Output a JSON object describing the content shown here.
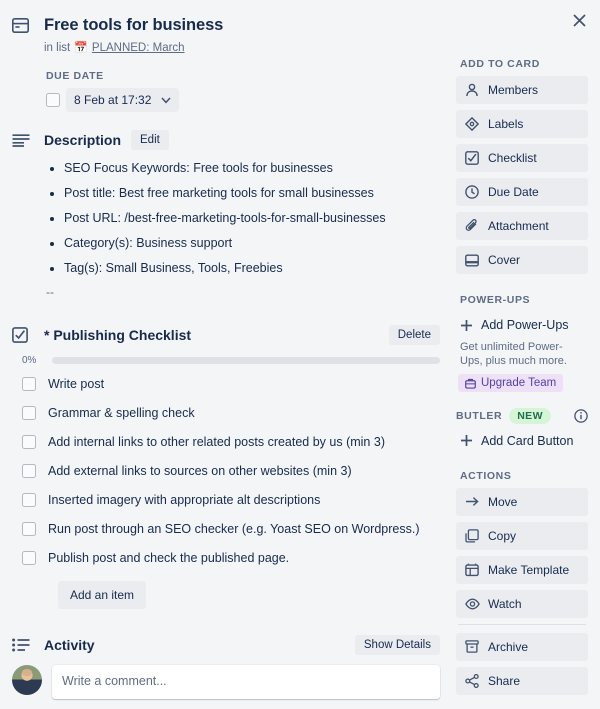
{
  "close_label": "×",
  "header": {
    "icon": "card-window-icon",
    "title": "Free tools for business",
    "in_list_prefix": "in list",
    "list_emoji": "📅",
    "list_name": "PLANNED: March"
  },
  "due": {
    "section_label": "DUE DATE",
    "value": "8 Feb at 17:32",
    "checked": false,
    "chevron": "chevron-down-icon"
  },
  "description": {
    "title": "Description",
    "edit_label": "Edit",
    "bullets": [
      "SEO Focus Keywords: Free tools for businesses",
      "Post title: Best free marketing tools for small businesses",
      "Post URL: /best-free-marketing-tools-for-small-businesses",
      "Category(s): Business support",
      "Tag(s): Small Business, Tools, Freebies"
    ],
    "trailing": "--"
  },
  "checklist": {
    "title": "* Publishing Checklist",
    "delete_label": "Delete",
    "percent_label": "0%",
    "percent_value": 0,
    "items": [
      "Write post",
      "Grammar & spelling check",
      "Add internal links to other related posts created by us (min 3)",
      "Add external links to sources on other websites (min 3)",
      "Inserted imagery with appropriate alt descriptions",
      "Run post through an SEO checker (e.g. Yoast SEO on Wordpress.)",
      "Publish post and check the published page."
    ],
    "add_item_label": "Add an item"
  },
  "activity": {
    "title": "Activity",
    "show_details_label": "Show Details",
    "comment_placeholder": "Write a comment..."
  },
  "sidebar": {
    "add_to_card": {
      "heading": "ADD TO CARD",
      "items": [
        {
          "label": "Members",
          "icon": "person-icon"
        },
        {
          "label": "Labels",
          "icon": "label-tag-icon"
        },
        {
          "label": "Checklist",
          "icon": "checkbox-check-icon"
        },
        {
          "label": "Due Date",
          "icon": "clock-icon"
        },
        {
          "label": "Attachment",
          "icon": "paperclip-icon"
        },
        {
          "label": "Cover",
          "icon": "cover-window-icon"
        }
      ]
    },
    "power_ups": {
      "heading": "POWER-UPS",
      "add_label": "Add Power-Ups",
      "note": "Get unlimited Power-Ups, plus much more.",
      "upgrade_label": "Upgrade Team",
      "upgrade_icon": "briefcase-icon"
    },
    "butler": {
      "heading": "BUTLER",
      "badge": "NEW",
      "info_icon": "info-circle-icon",
      "add_label": "Add Card Button"
    },
    "actions": {
      "heading": "ACTIONS",
      "items": [
        {
          "label": "Move",
          "icon": "arrow-right-icon"
        },
        {
          "label": "Copy",
          "icon": "copy-icon"
        },
        {
          "label": "Make Template",
          "icon": "template-icon"
        },
        {
          "label": "Watch",
          "icon": "eye-icon"
        }
      ],
      "items_secondary": [
        {
          "label": "Archive",
          "icon": "archive-box-icon"
        },
        {
          "label": "Share",
          "icon": "share-icon"
        }
      ]
    }
  },
  "colors": {
    "background": "#f4f5f7",
    "button": "#ebecf0",
    "text": "#172b4d",
    "muted": "#5e6c84",
    "upgrade_badge_bg": "#eee0f5",
    "upgrade_badge_text": "#5243aa",
    "new_badge_bg": "#d6f5d6",
    "new_badge_text": "#216e4e"
  }
}
